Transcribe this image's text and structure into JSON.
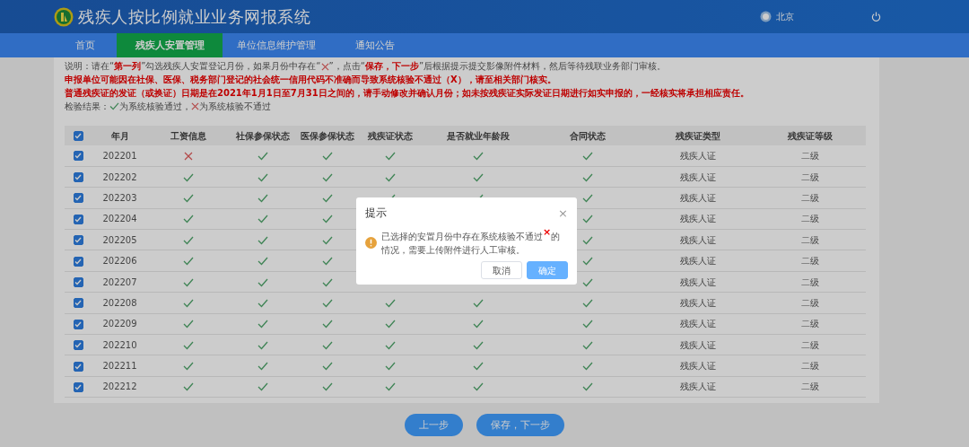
{
  "header": {
    "title": "残疾人按比例就业业务网报系统",
    "user": "北京"
  },
  "nav": [
    {
      "label": "首页",
      "selected": false
    },
    {
      "label": "残疾人安置管理",
      "selected": true
    },
    {
      "label": "单位信息维护管理",
      "selected": false
    },
    {
      "label": "通知公告",
      "selected": false
    }
  ],
  "notes": {
    "line1_before": "说明：请在“**第一列**”勾选残疾人安置登记月份，如果月份中存在“",
    "line1_after": "”，点击“**保存，下一步**”后根据提示提交影像附件材料，然后等待残联业务部门审核。",
    "warnings": [
      "申报单位可能因在社保、医保、税务部门登记的社会统一信用代码不准确而导致系统核验不通过（X），请至相关部门核实。",
      "普通残疾证的发证（或换证）日期是在2021年1月1日至7月31日之间的，请手动修改并确认月份；如未按残疾证实际发证日期进行如实申报的，一经核实将承担相应责任。"
    ],
    "legend_label": "检验结果：",
    "legend_pass": "为系统核验通过，",
    "legend_fail": "为系统核验不通过"
  },
  "table": {
    "all_checked": true,
    "columns": [
      "年月",
      "工资信息",
      "社保参保状态",
      "医保参保状态",
      "残疾证状态",
      "是否就业年龄段",
      "合同状态",
      "残疾证类型",
      "残疾证等级"
    ],
    "rows": [
      {
        "checked": true,
        "month": "202201",
        "wage": false,
        "social": true,
        "medical": true,
        "cert": true,
        "age": true,
        "contract": true,
        "cert_type": "残疾人证",
        "grade": "二级"
      },
      {
        "checked": true,
        "month": "202202",
        "wage": true,
        "social": true,
        "medical": true,
        "cert": true,
        "age": true,
        "contract": true,
        "cert_type": "残疾人证",
        "grade": "二级"
      },
      {
        "checked": true,
        "month": "202203",
        "wage": true,
        "social": true,
        "medical": true,
        "cert": true,
        "age": true,
        "contract": true,
        "cert_type": "残疾人证",
        "grade": "二级"
      },
      {
        "checked": true,
        "month": "202204",
        "wage": true,
        "social": true,
        "medical": true,
        "cert": null,
        "age": null,
        "contract": true,
        "cert_type": "残疾人证",
        "grade": "二级"
      },
      {
        "checked": true,
        "month": "202205",
        "wage": true,
        "social": true,
        "medical": true,
        "cert": null,
        "age": null,
        "contract": true,
        "cert_type": "残疾人证",
        "grade": "二级"
      },
      {
        "checked": true,
        "month": "202206",
        "wage": true,
        "social": true,
        "medical": true,
        "cert": null,
        "age": null,
        "contract": true,
        "cert_type": "残疾人证",
        "grade": "二级"
      },
      {
        "checked": true,
        "month": "202207",
        "wage": true,
        "social": true,
        "medical": true,
        "cert": null,
        "age": null,
        "contract": true,
        "cert_type": "残疾人证",
        "grade": "二级"
      },
      {
        "checked": true,
        "month": "202208",
        "wage": true,
        "social": true,
        "medical": true,
        "cert": true,
        "age": true,
        "contract": true,
        "cert_type": "残疾人证",
        "grade": "二级"
      },
      {
        "checked": true,
        "month": "202209",
        "wage": true,
        "social": true,
        "medical": true,
        "cert": true,
        "age": true,
        "contract": true,
        "cert_type": "残疾人证",
        "grade": "二级"
      },
      {
        "checked": true,
        "month": "202210",
        "wage": true,
        "social": true,
        "medical": true,
        "cert": true,
        "age": true,
        "contract": true,
        "cert_type": "残疾人证",
        "grade": "二级"
      },
      {
        "checked": true,
        "month": "202211",
        "wage": true,
        "social": true,
        "medical": true,
        "cert": true,
        "age": true,
        "contract": true,
        "cert_type": "残疾人证",
        "grade": "二级"
      },
      {
        "checked": true,
        "month": "202212",
        "wage": true,
        "social": true,
        "medical": true,
        "cert": true,
        "age": true,
        "contract": true,
        "cert_type": "残疾人证",
        "grade": "二级"
      }
    ]
  },
  "buttons": [
    "上一步",
    "保存，下一步"
  ],
  "dialog": {
    "title": "提示",
    "close": "×",
    "message": "已选择的安置月份中存在系统核验不通过$^{×}$的情况，需要上传附件进行人工审核。",
    "buttons": [
      {
        "label": "取消",
        "kind": "default"
      },
      {
        "label": "确定",
        "kind": "primary"
      }
    ]
  }
}
